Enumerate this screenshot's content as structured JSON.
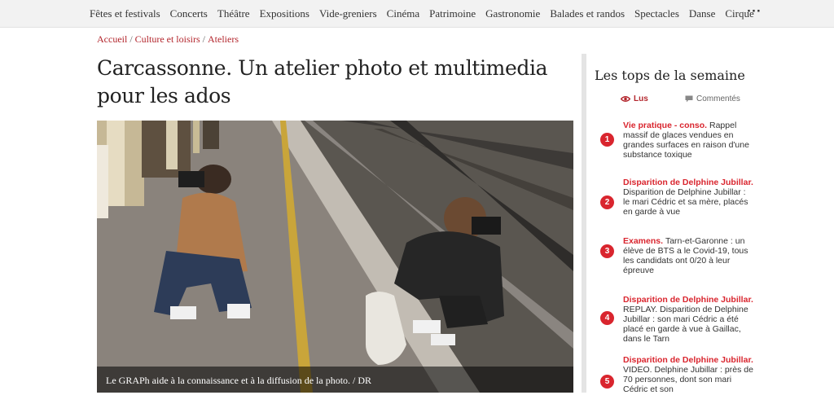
{
  "nav": {
    "items": [
      "Fêtes et festivals",
      "Concerts",
      "Théâtre",
      "Expositions",
      "Vide-greniers",
      "Cinéma",
      "Patrimoine",
      "Gastronomie",
      "Balades et randos",
      "Spectacles",
      "Danse",
      "Cirque"
    ],
    "more_label": "···"
  },
  "breadcrumb": {
    "home": "Accueil",
    "section": "Culture et loisirs",
    "subsection": "Ateliers"
  },
  "article": {
    "title": "Carcassonne. Un atelier photo et multimedia pour les ados",
    "caption": "Le GRAPh aide à la connaissance et à la diffusion de la photo.  / DR"
  },
  "sidebar": {
    "title": "Les tops de la semaine",
    "tab_read": "Lus",
    "tab_comments": "Commentés",
    "items": [
      {
        "num": "1",
        "category": "Vie pratique - conso.",
        "text": "Rappel massif de glaces vendues en grandes surfaces en raison d'une substance toxique"
      },
      {
        "num": "2",
        "category": "Disparition de Delphine Jubillar.",
        "text": "Disparition de Delphine Jubillar : le mari Cédric et sa mère, placés en garde à vue"
      },
      {
        "num": "3",
        "category": "Examens.",
        "text": "Tarn-et-Garonne : un élève de BTS a le Covid-19, tous les candidats ont 0/20 à leur épreuve"
      },
      {
        "num": "4",
        "category": "Disparition de Delphine Jubillar.",
        "text": "REPLAY. Disparition de Delphine Jubillar : son mari Cédric a été placé en garde à vue à Gaillac, dans le Tarn"
      },
      {
        "num": "5",
        "category": "Disparition de Delphine Jubillar.",
        "text": "VIDEO. Delphine Jubillar : près de 70 personnes, dont son mari Cédric et son"
      }
    ]
  },
  "colors": {
    "accent": "#d9252e",
    "link": "#b3262d"
  }
}
